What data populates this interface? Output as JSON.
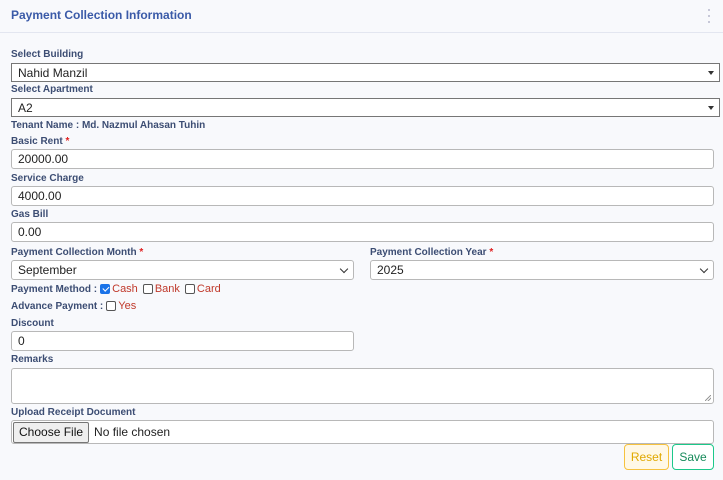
{
  "header": {
    "title": "Payment Collection Information"
  },
  "building": {
    "label": "Select Building",
    "value": "Nahid Manzil"
  },
  "apartment": {
    "label": "Select Apartment",
    "value": "A2"
  },
  "tenant": {
    "text": "Tenant Name : Md. Nazmul Ahasan Tuhin"
  },
  "basic_rent": {
    "label": "Basic Rent",
    "required": "*",
    "value": "20000.00"
  },
  "service_charge": {
    "label": "Service Charge",
    "value": "4000.00"
  },
  "gas_bill": {
    "label": "Gas Bill",
    "value": "0.00"
  },
  "month": {
    "label": "Payment Collection Month",
    "required": "*",
    "value": "September"
  },
  "year": {
    "label": "Payment Collection Year",
    "required": "*",
    "value": "2025"
  },
  "payment_method": {
    "label": "Payment Method :",
    "options": [
      {
        "label": "Cash",
        "checked": true
      },
      {
        "label": "Bank",
        "checked": false
      },
      {
        "label": "Card",
        "checked": false
      }
    ]
  },
  "advance_payment": {
    "label": "Advance Payment :",
    "option": "Yes",
    "checked": false
  },
  "discount": {
    "label": "Discount",
    "value": "0"
  },
  "remarks": {
    "label": "Remarks",
    "value": ""
  },
  "upload": {
    "label": "Upload Receipt Document",
    "button": "Choose File",
    "status": "No file chosen"
  },
  "actions": {
    "reset": "Reset",
    "save": "Save"
  },
  "colors": {
    "accent": "#3a5aa8",
    "required": "#e02020",
    "option_text": "#c0392b",
    "reset": "#f6c23e",
    "save": "#1cc88a"
  }
}
